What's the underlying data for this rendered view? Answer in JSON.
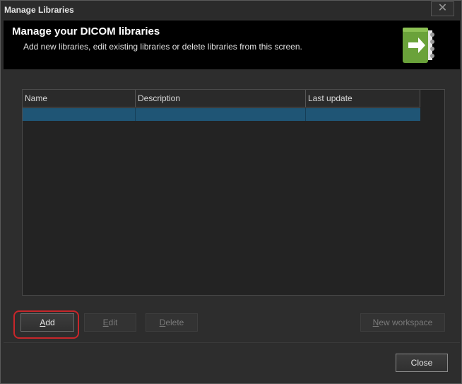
{
  "window": {
    "title": "Manage Libraries",
    "close_glyph": "✕"
  },
  "header": {
    "title": "Manage your DICOM libraries",
    "subtitle": "Add new libraries, edit existing libraries or delete libraries from this screen.",
    "icon": "library-book-arrow-icon",
    "icon_color": "#6aa23a"
  },
  "table": {
    "columns": [
      "Name",
      "Description",
      "Last update"
    ],
    "rows": [
      {
        "name": "",
        "description": "",
        "last_update": "",
        "selected": true
      }
    ],
    "selection_color": "#1f5575"
  },
  "buttons": {
    "add": {
      "label": "Add",
      "mnemonic": "A",
      "enabled": true,
      "highlighted": true
    },
    "edit": {
      "label": "Edit",
      "mnemonic": "E",
      "enabled": false
    },
    "delete": {
      "label": "Delete",
      "mnemonic": "D",
      "enabled": false
    },
    "new_workspace": {
      "label": "New workspace",
      "mnemonic": "N",
      "enabled": false
    },
    "close": {
      "label": "Close",
      "enabled": true
    }
  },
  "highlight_color": "#c8262a"
}
